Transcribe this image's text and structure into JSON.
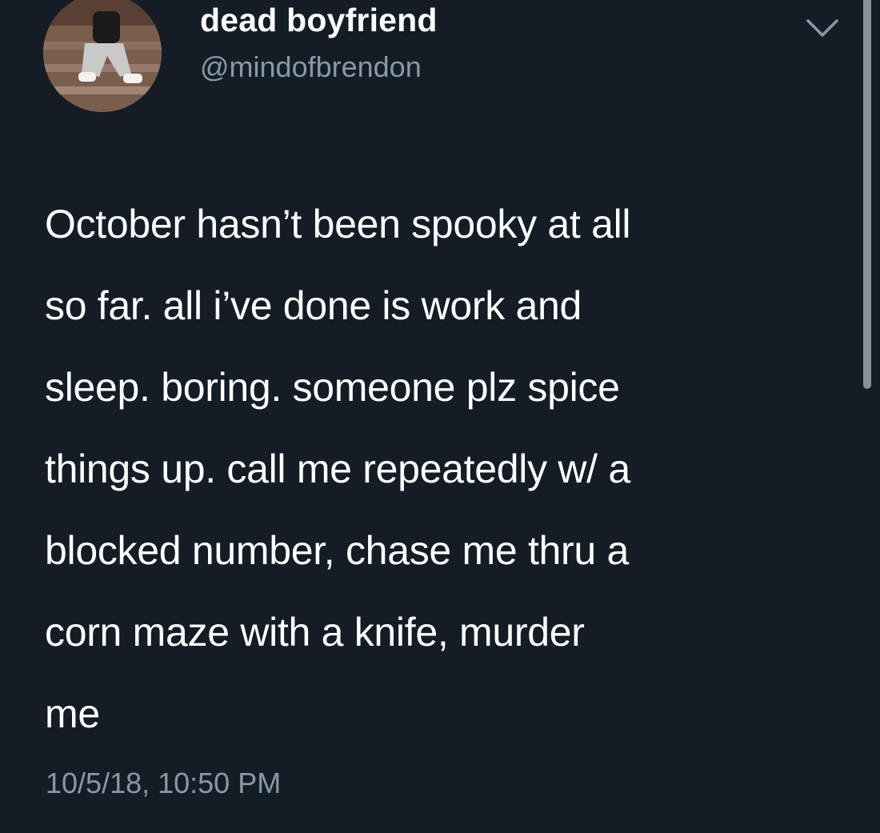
{
  "user": {
    "display_name": "dead boyfriend",
    "handle": "@mindofbrendon",
    "avatar_icon": "user-avatar-photo"
  },
  "menu": {
    "icon": "chevron-down-icon"
  },
  "tweet": {
    "lines": [
      "October hasn’t been spooky at all",
      "so far. all i’ve done is work and",
      "sleep. boring. someone plz spice",
      "things up. call me repeatedly w/ a",
      "blocked number, chase me thru a",
      "corn maze with a knife, murder",
      "me"
    ],
    "timestamp": "10/5/18, 10:50 PM"
  },
  "colors": {
    "background": "#141d26",
    "text": "#ffffff",
    "secondary_text": "#8899a6",
    "scrollbar": "#8a9299"
  }
}
